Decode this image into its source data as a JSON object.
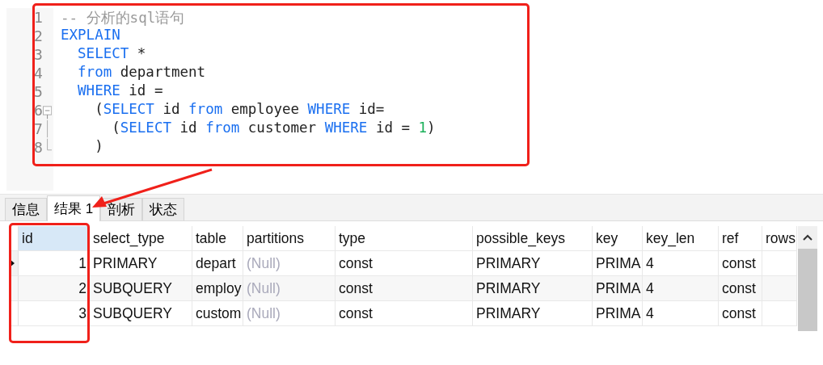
{
  "editor": {
    "lines": [
      {
        "number": "1",
        "kind": "plain",
        "tokens": [
          {
            "kind": "comment",
            "text": "-- 分析的sql语句"
          }
        ]
      },
      {
        "number": "2",
        "kind": "plain",
        "tokens": [
          {
            "kind": "keyword",
            "text": "EXPLAIN"
          }
        ]
      },
      {
        "number": "3",
        "kind": "plain",
        "tokens": [
          {
            "kind": "keyword",
            "text": "  SELECT"
          },
          {
            "kind": "plain",
            "text": " *"
          }
        ]
      },
      {
        "number": "4",
        "kind": "plain",
        "tokens": [
          {
            "kind": "keyword",
            "text": "  from"
          },
          {
            "kind": "plain",
            "text": " department"
          }
        ]
      },
      {
        "number": "5",
        "kind": "plain",
        "tokens": [
          {
            "kind": "keyword",
            "text": "  WHERE"
          },
          {
            "kind": "plain",
            "text": " id ="
          }
        ]
      },
      {
        "number": "6",
        "kind": "foldstart",
        "tokens": [
          {
            "kind": "plain",
            "text": "    ("
          },
          {
            "kind": "keyword",
            "text": "SELECT"
          },
          {
            "kind": "plain",
            "text": " id "
          },
          {
            "kind": "keyword",
            "text": "from"
          },
          {
            "kind": "plain",
            "text": " employee "
          },
          {
            "kind": "keyword",
            "text": "WHERE"
          },
          {
            "kind": "plain",
            "text": " id="
          }
        ]
      },
      {
        "number": "7",
        "kind": "foldbody",
        "tokens": [
          {
            "kind": "plain",
            "text": "      ("
          },
          {
            "kind": "keyword",
            "text": "SELECT"
          },
          {
            "kind": "plain",
            "text": " id "
          },
          {
            "kind": "keyword",
            "text": "from"
          },
          {
            "kind": "plain",
            "text": " customer "
          },
          {
            "kind": "keyword",
            "text": "WHERE"
          },
          {
            "kind": "plain",
            "text": " id = "
          },
          {
            "kind": "number",
            "text": "1"
          },
          {
            "kind": "plain",
            "text": ")"
          }
        ]
      },
      {
        "number": "8",
        "kind": "foldend",
        "tokens": [
          {
            "kind": "plain",
            "text": "    )"
          }
        ]
      }
    ]
  },
  "tabs": [
    {
      "label": "信息",
      "selected": false
    },
    {
      "label": "结果 1",
      "selected": true
    },
    {
      "label": "剖析",
      "selected": false
    },
    {
      "label": "状态",
      "selected": false
    }
  ],
  "table": {
    "columns": [
      {
        "label": "id",
        "kind": "number",
        "selected": true
      },
      {
        "label": "select_type",
        "kind": "text",
        "selected": false
      },
      {
        "label": "table",
        "kind": "text",
        "selected": false
      },
      {
        "label": "partitions",
        "kind": "text",
        "muted": true,
        "selected": false
      },
      {
        "label": "type",
        "kind": "text",
        "selected": false
      },
      {
        "label": "possible_keys",
        "kind": "text",
        "selected": false
      },
      {
        "label": "key",
        "kind": "text",
        "selected": false
      },
      {
        "label": "key_len",
        "kind": "text",
        "selected": false
      },
      {
        "label": "ref",
        "kind": "text",
        "selected": false
      },
      {
        "label": "rows",
        "kind": "text",
        "selected": false
      }
    ],
    "rows": [
      {
        "selected": true,
        "cells": [
          "1",
          "PRIMARY",
          "depart",
          "(Null)",
          "const",
          "PRIMARY",
          "PRIMA",
          "4",
          "const",
          ""
        ]
      },
      {
        "selected": false,
        "cells": [
          "2",
          "SUBQUERY",
          "employ",
          "(Null)",
          "const",
          "PRIMARY",
          "PRIMA",
          "4",
          "const",
          ""
        ]
      },
      {
        "selected": false,
        "cells": [
          "3",
          "SUBQUERY",
          "custom",
          "(Null)",
          "const",
          "PRIMARY",
          "PRIMA",
          "4",
          "const",
          ""
        ]
      }
    ]
  }
}
